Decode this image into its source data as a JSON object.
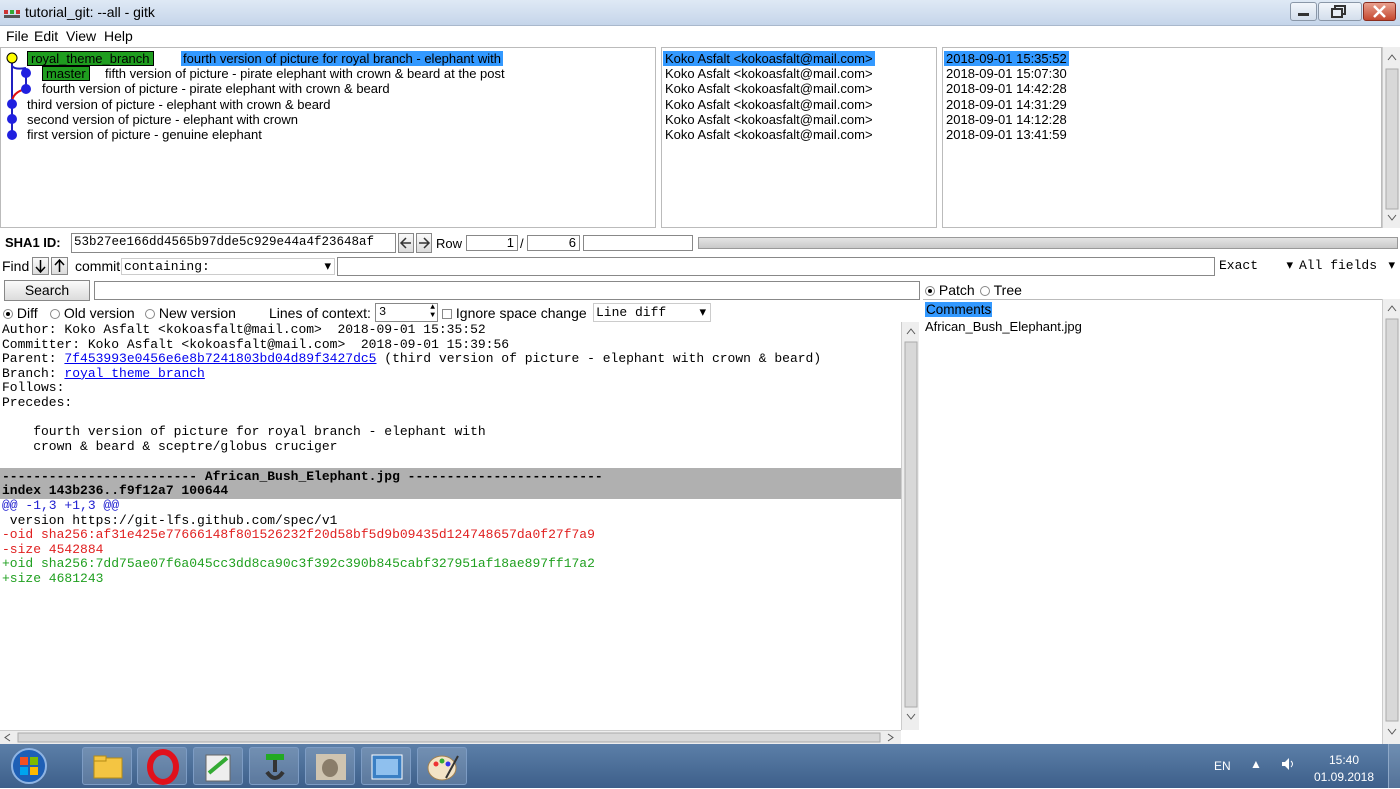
{
  "window": {
    "title": "tutorial_git: --all - gitk"
  },
  "menu": [
    "File",
    "Edit",
    "View",
    "Help"
  ],
  "commits": [
    {
      "subject": "fourth version of picture for royal branch - elephant with",
      "author": "Koko Asfalt <kokoasfalt@mail.com>",
      "date": "2018-09-01 15:35:52",
      "tag": "royal_theme_branch",
      "selected": true
    },
    {
      "subject": "fifth version of picture - pirate elephant with crown & beard at the post",
      "author": "Koko Asfalt <kokoasfalt@mail.com>",
      "date": "2018-09-01 15:07:30",
      "tag": "master"
    },
    {
      "subject": "fourth version of picture - pirate elephant with crown & beard",
      "author": "Koko Asfalt <kokoasfalt@mail.com>",
      "date": "2018-09-01 14:42:28"
    },
    {
      "subject": "third version of picture - elephant with crown & beard",
      "author": "Koko Asfalt <kokoasfalt@mail.com>",
      "date": "2018-09-01 14:31:29"
    },
    {
      "subject": "second version of picture - elephant with crown",
      "author": "Koko Asfalt <kokoasfalt@mail.com>",
      "date": "2018-09-01 14:12:28"
    },
    {
      "subject": "first version of picture - genuine elephant",
      "author": "Koko Asfalt <kokoasfalt@mail.com>",
      "date": "2018-09-01 13:41:59"
    }
  ],
  "sha": {
    "label": "SHA1 ID:",
    "value": "53b27ee166dd4565b97dde5c929e44a4f23648af",
    "row_label": "Row",
    "row_current": "1",
    "row_sep": "/",
    "row_total": "6"
  },
  "find": {
    "label": "Find",
    "commit_label": "commit",
    "containing": "containing:",
    "exact": "Exact",
    "all_fields": "All fields"
  },
  "search": {
    "button": "Search"
  },
  "diff_options": {
    "diff": "Diff",
    "old": "Old version",
    "new": "New version",
    "context_label": "Lines of context:",
    "context_value": "3",
    "ignore_space": "Ignore space change",
    "line_diff": "Line diff"
  },
  "details": {
    "author": "Author: Koko Asfalt <kokoasfalt@mail.com>  2018-09-01 15:35:52",
    "committer": "Committer: Koko Asfalt <kokoasfalt@mail.com>  2018-09-01 15:39:56",
    "parent_label": "Parent: ",
    "parent_hash": "7f453993e0456e6e8b7241803bd04d89f3427dc5",
    "parent_subject": " (third version of picture - elephant with crown & beard)",
    "branch_label": "Branch: ",
    "branch_name": "royal_theme_branch",
    "follows": "Follows:",
    "precedes": "Precedes:",
    "message1": "    fourth version of picture for royal branch - elephant with",
    "message2": "    crown & beard & sceptre/globus cruciger",
    "file_header": "------------------------- African_Bush_Elephant.jpg -------------------------",
    "index": "index 143b236..f9f12a7 100644",
    "hunk": "@@ -1,3 +1,3 @@",
    "ctx": " version https://git-lfs.github.com/spec/v1",
    "del1": "-oid sha256:af31e425e77666148f801526232f20d58bf5d9b09435d124748657da0f27f7a9",
    "del2": "-size 4542884",
    "add1": "+oid sha256:7dd75ae07f6a045cc3dd8ca90c3f392c390b845cabf327951af18ae897ff17a2",
    "add2": "+size 4681243"
  },
  "files": {
    "patch": "Patch",
    "tree": "Tree",
    "comments": "Comments",
    "file1": "African_Bush_Elephant.jpg"
  },
  "taskbar": {
    "lang": "EN",
    "time": "15:40",
    "date": "01.09.2018"
  },
  "colors": {
    "selection": "#3399ff",
    "tag": "#1f9d1f",
    "deleted": "#e02020",
    "added": "#20a020",
    "hunk": "#2020d0",
    "link": "#0000ee"
  }
}
